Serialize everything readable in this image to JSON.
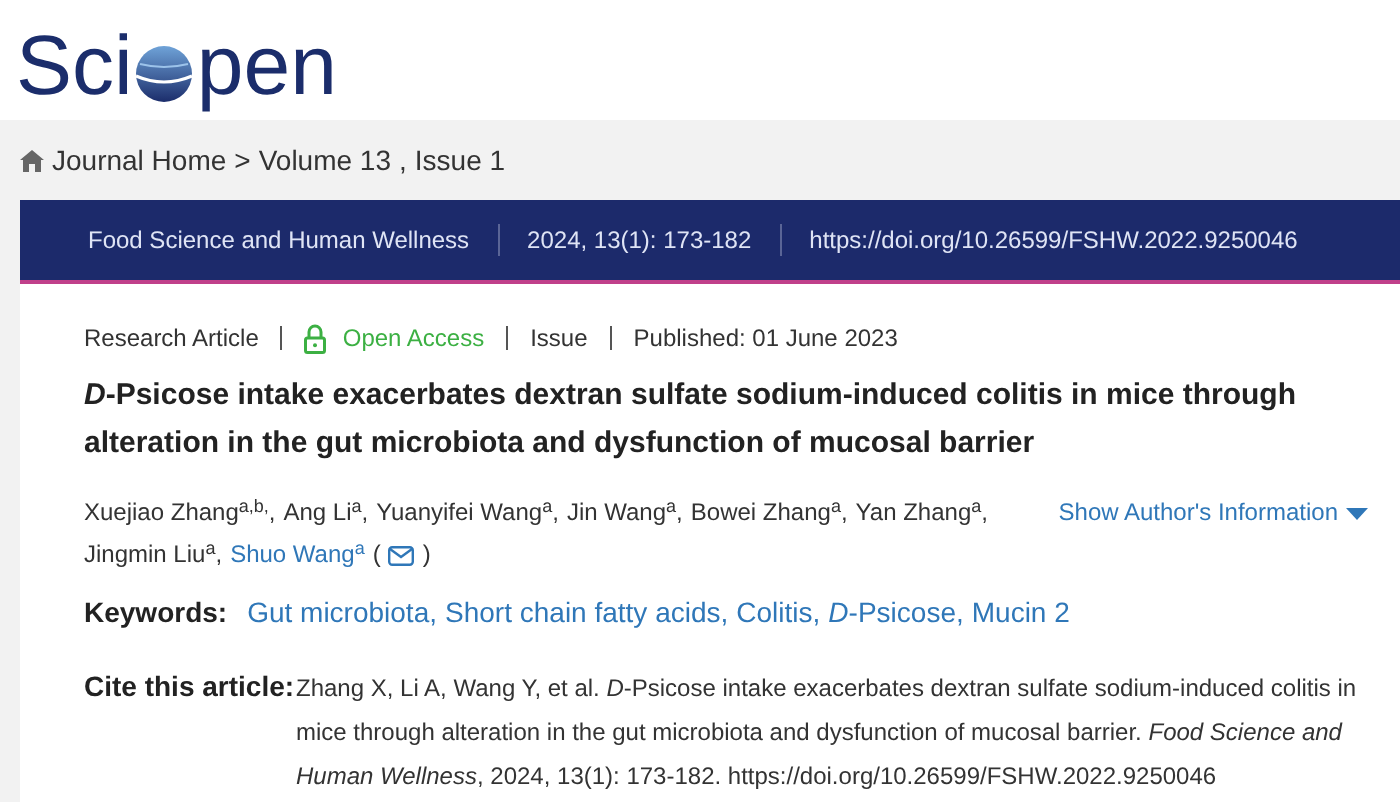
{
  "logo": {
    "left": "Sci",
    "right": "pen"
  },
  "breadcrumb": {
    "home": "Journal Home",
    "separator": ">",
    "volume": "Volume 13",
    "comma": ",",
    "issue": "Issue 1"
  },
  "journal_bar": [
    "Food Science and Human Wellness",
    "2024, 13(1): 173-182",
    "https://doi.org/10.26599/FSHW.2022.9250046"
  ],
  "meta": {
    "type": "Research Article",
    "access": "Open Access",
    "issue": "Issue",
    "published": "Published: 01 June 2023"
  },
  "title": "*D*-Psicose intake exacerbates dextran sulfate sodium-induced colitis in mice through alteration in the gut microbiota and dysfunction of mucosal barrier",
  "authors": [
    {
      "text": "Xuejiao Zhang$^{a,b,}$,",
      "kind": "plain"
    },
    {
      "text": "Ang Li$^{a}$,",
      "kind": "plain"
    },
    {
      "text": "Yuanyifei Wang$^{a}$,",
      "kind": "plain"
    },
    {
      "text": "Jin Wang$^{a}$,",
      "kind": "plain"
    },
    {
      "text": "Bowei Zhang$^{a}$,",
      "kind": "plain"
    },
    {
      "text": "Yan Zhang$^{a}$,",
      "kind": "plain"
    },
    {
      "text": "Jingmin Liu$^{a}$,",
      "kind": "plain"
    },
    {
      "text": "Shuo Wang$^{a}$",
      "kind": "corresponding"
    }
  ],
  "email_parens": [
    "(",
    ")"
  ],
  "show_info": "Show Author's Information",
  "keywords_label": "Keywords:",
  "keywords": [
    "Gut microbiota,",
    "Short chain fatty acids,",
    "Colitis,",
    "*D*-Psicose,",
    "Mucin 2"
  ],
  "cite_label": "Cite this article:",
  "citation": "Zhang X, Li A, Wang Y, et al. *D*-Psicose intake exacerbates dextran sulfate sodium-induced colitis in mice through alteration in the gut microbiota and dysfunction of mucosal barrier. *Food Science and Human Wellness*, 2024, 13(1): 173-182. https://doi.org/10.26599/FSHW.2022.9250046"
}
